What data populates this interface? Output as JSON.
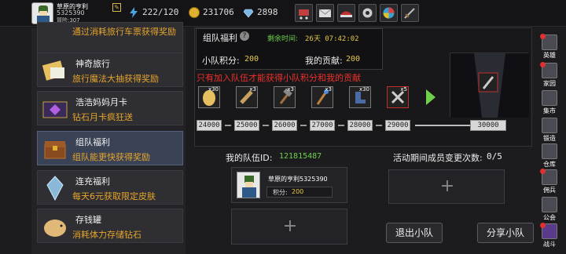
{
  "player": {
    "name": "草原的亨利",
    "id": "5325390",
    "level_label": "冒险:307"
  },
  "resources": [
    {
      "icon": "lightning-icon",
      "value": "222/120",
      "color": "#4aa3e0"
    },
    {
      "icon": "gold-coin-icon",
      "value": "231706",
      "color": "#e0b030"
    },
    {
      "icon": "diamond-icon",
      "value": "2898",
      "color": "#7ab8e8"
    }
  ],
  "top_buttons": [
    "shop-cart-icon",
    "mail-icon",
    "cap-icon",
    "settings-gear-icon",
    "spin-wheel-icon",
    "sword-icon"
  ],
  "sidebar": {
    "items": [
      {
        "title": "",
        "desc": "通过消耗旅行车票获得奖励",
        "icon": "ticket-icon"
      },
      {
        "title": "神奇旅行",
        "desc": "旅行魔法大抽获得奖励",
        "icon": "travel-icon"
      },
      {
        "title": "浩浩妈妈月卡",
        "desc": "钻石月卡疯狂送",
        "icon": "month-card-icon"
      },
      {
        "title": "组队福利",
        "desc": "组队能更快获得奖励",
        "icon": "chest-icon"
      },
      {
        "title": "连充福利",
        "desc": "每天6元获取限定皮肤",
        "icon": "crystal-icon"
      },
      {
        "title": "存钱罐",
        "desc": "消耗体力存储钻石",
        "icon": "piggy-bank-icon"
      }
    ]
  },
  "team": {
    "title": "组队福利",
    "remaining_label": "剩余时间:",
    "remaining_value": "26天 07:42:02",
    "team_points_label": "小队积分:",
    "team_points": "200",
    "my_contrib_label": "我的贡献:",
    "my_contrib": "200",
    "notice": "只有加入队伍才能获得小队积分和我的贡献",
    "rewards": [
      {
        "qty": "x30",
        "icon": "egg-icon"
      },
      {
        "qty": "x3",
        "icon": "scroll-icon"
      },
      {
        "qty": "x3",
        "icon": "hammer-icon"
      },
      {
        "qty": "x3",
        "icon": "staff-icon"
      },
      {
        "qty": "x30",
        "icon": "boots-icon"
      },
      {
        "qty": "x5",
        "icon": "crossed-tools-icon"
      }
    ],
    "milestones": [
      "24000",
      "25000",
      "26000",
      "27000",
      "28000",
      "29000",
      "30000"
    ],
    "progress": 0
  },
  "my_team": {
    "id_label": "我的队伍ID:",
    "id_value": "121815487",
    "member_name": "草原的亨利5325390",
    "member_points_label": "积分:",
    "member_points": "200",
    "change_label": "活动期间成员变更次数:",
    "change_value": "0/5",
    "leave_button": "退出小队",
    "share_button": "分享小队"
  },
  "right_nav": [
    {
      "label": "英雄",
      "icon": "hero-icon",
      "badge": true
    },
    {
      "label": "家园",
      "icon": "home-icon",
      "badge": true
    },
    {
      "label": "集市",
      "icon": "market-icon",
      "badge": false
    },
    {
      "label": "锻造",
      "icon": "forge-icon",
      "badge": false
    },
    {
      "label": "仓库",
      "icon": "warehouse-icon",
      "badge": false
    },
    {
      "label": "佣兵",
      "icon": "mercenary-icon",
      "badge": true
    },
    {
      "label": "公会",
      "icon": "guild-icon",
      "badge": false
    },
    {
      "label": "战斗",
      "icon": "battle-icon",
      "badge": true
    }
  ]
}
